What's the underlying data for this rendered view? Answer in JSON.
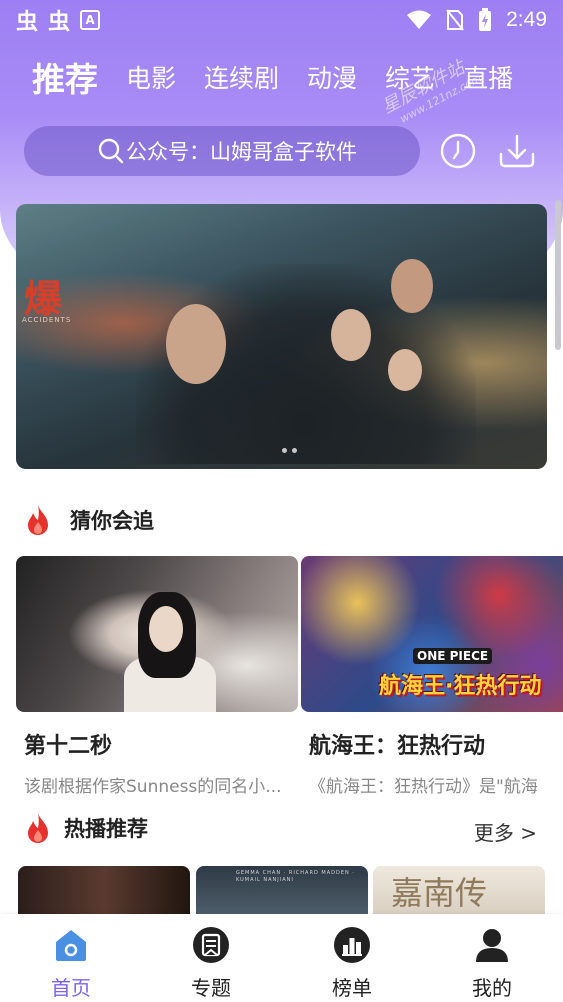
{
  "status_bar": {
    "left_icons": [
      "虫",
      "虫"
    ],
    "time": "2:49"
  },
  "tabs": [
    {
      "label": "推荐",
      "active": true
    },
    {
      "label": "电影",
      "active": false
    },
    {
      "label": "连续剧",
      "active": false
    },
    {
      "label": "动漫",
      "active": false
    },
    {
      "label": "综艺",
      "active": false
    },
    {
      "label": "直播",
      "active": false
    }
  ],
  "watermark": {
    "text": "星辰软件站",
    "url": "www.121nz.com"
  },
  "search": {
    "text": "公众号：山姆哥盒子软件"
  },
  "header_buttons": {
    "history_icon": "clock-icon",
    "download_icon": "download-icon"
  },
  "banner": {
    "title": "爆",
    "subtitle": "ACCIDENTS"
  },
  "section_guess": {
    "title": "猜你会追"
  },
  "cards": [
    {
      "name": "第十二秒",
      "desc": "该剧根据作家Sunness的同名小..."
    },
    {
      "name": "航海王：狂热行动",
      "desc": "《航海王：狂热行动》是\"航海"
    }
  ],
  "card2_art": {
    "logo": "ONE PIECE",
    "title": "航海王·狂热行动"
  },
  "section_hot": {
    "title": "热播推荐",
    "more": "更多 >"
  },
  "thumb3_text": "嘉南传",
  "bottom_nav": [
    {
      "label": "首页",
      "active": true
    },
    {
      "label": "专题",
      "active": false
    },
    {
      "label": "榜单",
      "active": false
    },
    {
      "label": "我的",
      "active": false
    }
  ],
  "colors": {
    "accent": "#7c63e8",
    "flame": "#e5322d"
  }
}
